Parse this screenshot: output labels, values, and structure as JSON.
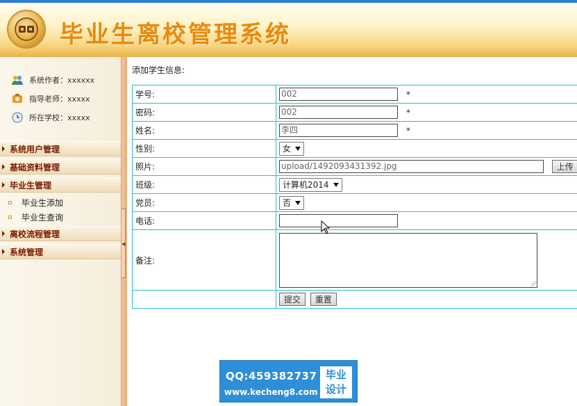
{
  "app": {
    "title": "毕业生离校管理系统"
  },
  "sidebar": {
    "info": [
      {
        "label": "系统作者：xxxxxx",
        "icon": "users-icon"
      },
      {
        "label": "指导老师：xxxxx",
        "icon": "teacher-icon"
      },
      {
        "label": "所在学校：xxxxx",
        "icon": "clock-icon"
      }
    ],
    "menus": [
      {
        "label": "系统用户管理"
      },
      {
        "label": "基础资料管理"
      },
      {
        "label": "毕业生管理",
        "items": [
          "毕业生添加",
          "毕业生查询"
        ]
      },
      {
        "label": "离校流程管理"
      },
      {
        "label": "系统管理"
      }
    ]
  },
  "form": {
    "heading": "添加学生信息:",
    "required_mark": "*",
    "fields": {
      "student_id": {
        "label": "学号:",
        "value": "002"
      },
      "password": {
        "label": "密码:",
        "value": "002"
      },
      "name": {
        "label": "姓名:",
        "value": "李四"
      },
      "gender": {
        "label": "性别:",
        "value": "女"
      },
      "photo": {
        "label": "照片:",
        "value": "upload/1492093431392.jpg",
        "upload_button": "上传"
      },
      "class": {
        "label": "班级:",
        "value": "计算机2014"
      },
      "party_member": {
        "label": "党员:",
        "value": "否"
      },
      "phone": {
        "label": "电话:",
        "value": ""
      },
      "remark": {
        "label": "备注:",
        "value": ""
      }
    },
    "submit_label": "提交",
    "reset_label": "重置"
  },
  "watermark": {
    "qq": "QQ:459382737",
    "url": "www.kecheng8.com",
    "badge_line1": "毕业",
    "badge_line2": "设计"
  },
  "colors": {
    "accent_title": "#e98a0c",
    "table_border": "#27c0d6",
    "menu_text": "#7a1a00",
    "watermark_bg": "#2e8fd8"
  }
}
